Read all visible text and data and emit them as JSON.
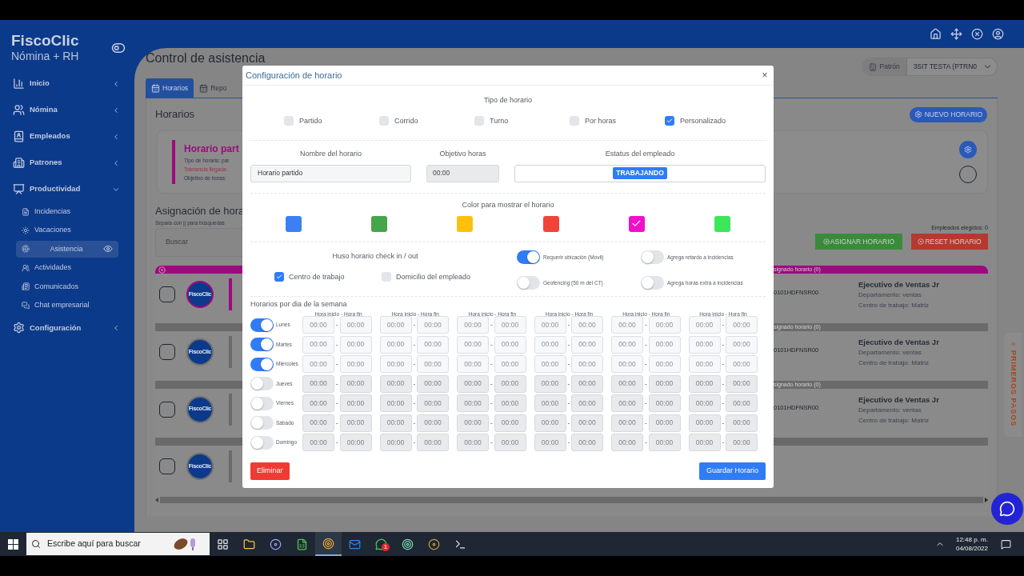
{
  "sidebar": {
    "logo": "FiscoClic",
    "subtitle": "Nómina + RH",
    "items": [
      {
        "label": "Inicio",
        "expanded": false
      },
      {
        "label": "Nómina",
        "expanded": false
      },
      {
        "label": "Empleados",
        "expanded": false
      },
      {
        "label": "Patrones",
        "expanded": false
      },
      {
        "label": "Productividad",
        "expanded": true,
        "children": [
          {
            "label": "Incidencias",
            "selected": false
          },
          {
            "label": "Vacaciones",
            "selected": false
          },
          {
            "label": "Asistencia",
            "selected": true
          },
          {
            "label": "Actividades",
            "selected": false
          },
          {
            "label": "Comunicados",
            "selected": false
          },
          {
            "label": "Chat empresarial",
            "selected": false
          }
        ]
      },
      {
        "label": "Configuración",
        "expanded": false
      }
    ]
  },
  "content": {
    "title": "Control de asistencia",
    "patron": {
      "label": "Patrón",
      "value": "3SIT TESTA (PTRN0"
    },
    "tabs": [
      {
        "label": "Horarios",
        "selected": true
      },
      {
        "label": "Repo",
        "selected": false
      }
    ],
    "heading": "Horarios",
    "new_button": "NUEVO HORARIO",
    "card": {
      "title": "Horario part",
      "radio_selected": false,
      "lines": [
        {
          "text": "Tipo de horario: par",
          "kind": "normal"
        },
        {
          "text": "Tolerancia llegada:",
          "kind": "warning"
        },
        {
          "text": "Objetivo de horas:",
          "kind": "normal"
        }
      ]
    },
    "assign": {
      "title": "Asignación de hora",
      "hint": "Separa con || para búsquedas",
      "search_placeholder": "Buscar",
      "count": "Empleados elegidos: 0",
      "assign_button": "ASIGNAR HORARIO",
      "reset_button": "RESET HORARIO"
    },
    "employees": [
      {
        "avatar": "FiscoClic",
        "highlighted": true,
        "checked": false,
        "header": "signado horario (0)",
        "rfc": "0101HDFNSR00",
        "position": "Ejecutivo de Ventas Jr",
        "department": "Departamento: ventas",
        "workplace": "Centro de trabajo: Matriz"
      },
      {
        "avatar": "FiscoClic",
        "highlighted": false,
        "checked": false,
        "header": "signado horario (0)",
        "rfc": "0101HDFNSR00",
        "position": "Ejecutivo de Ventas Jr",
        "department": "Departamento: ventas",
        "workplace": "Centro de trabajo: Matriz"
      },
      {
        "avatar": "FiscoClic",
        "highlighted": false,
        "checked": false,
        "header": "signado horario (0)",
        "rfc": "0101HDFNSR00",
        "position": "Ejecutivo de Ventas Jr",
        "department": "Departamento: ventas",
        "workplace": "Centro de trabajo: Matriz"
      },
      {
        "avatar": "FiscoClic",
        "highlighted": false,
        "checked": false
      }
    ],
    "side_tab": "PRIMEROS PASOS"
  },
  "modal": {
    "title": "Configuración de horario",
    "close": "×",
    "type_label": "Tipo de horario",
    "types": [
      {
        "label": "Partido",
        "checked": false
      },
      {
        "label": "Corrido",
        "checked": false
      },
      {
        "label": "Turno",
        "checked": false
      },
      {
        "label": "Por horas",
        "checked": false
      },
      {
        "label": "Personalizado",
        "checked": true
      }
    ],
    "name_label": "Nombre del horario",
    "name_value": "Horario partido",
    "goal_label": "Objetivo horas",
    "goal_value": "00:00",
    "status_label": "Estatus del empleado",
    "status_badge": "TRABAJANDO",
    "color_label": "Color para mostrar el horario",
    "colors": [
      {
        "color": "#3d80f5",
        "selected": false
      },
      {
        "color": "#46a64a",
        "selected": false
      },
      {
        "color": "#fdc00d",
        "selected": false
      },
      {
        "color": "#f2433a",
        "selected": false
      },
      {
        "color": "#f20fcb",
        "selected": true
      },
      {
        "color": "#3de65a",
        "selected": false
      }
    ],
    "tz_label": "Huso horario check in / out",
    "tz_options": [
      {
        "label": "Centro de trabajo",
        "checked": true
      },
      {
        "label": "Domicilio del empleado",
        "checked": false
      }
    ],
    "toggles": [
      {
        "label": "Requerir ubicación (Movil)",
        "on": true
      },
      {
        "label": "Agrega retardo a incidencias",
        "on": false
      },
      {
        "label": "Geofencing (50 m del CT)",
        "on": false
      },
      {
        "label": "Agrega horas extra a incidencias",
        "on": false
      }
    ],
    "week_label": "Horarios por dia de la semana",
    "slot_headers": [
      "Hora inicio - Hora fin",
      "Hora inicio - Hora fin",
      "Hora inicio - Hora fin",
      "Hora inicio - Hora fin",
      "Hora inicio - Hora fin",
      "Hora inicio - Hora fin"
    ],
    "separator": "-",
    "days": [
      {
        "name": "Lunes",
        "on": true,
        "slots": [
          {
            "start": "00:00",
            "end": "00:00"
          },
          {
            "start": "00:00",
            "end": "00:00"
          },
          {
            "start": "00:00",
            "end": "00:00"
          },
          {
            "start": "00:00",
            "end": "00:00"
          },
          {
            "start": "00:00",
            "end": "00:00"
          },
          {
            "start": "00:00",
            "end": "00:00"
          }
        ]
      },
      {
        "name": "Martes",
        "on": true,
        "slots": [
          {
            "start": "00:00",
            "end": "00:00"
          },
          {
            "start": "00:00",
            "end": "00:00"
          },
          {
            "start": "00:00",
            "end": "00:00"
          },
          {
            "start": "00:00",
            "end": "00:00"
          },
          {
            "start": "00:00",
            "end": "00:00"
          },
          {
            "start": "00:00",
            "end": "00:00"
          }
        ]
      },
      {
        "name": "Miércoles",
        "on": true,
        "slots": [
          {
            "start": "00:00",
            "end": "00:00"
          },
          {
            "start": "00:00",
            "end": "00:00"
          },
          {
            "start": "00:00",
            "end": "00:00"
          },
          {
            "start": "00:00",
            "end": "00:00"
          },
          {
            "start": "00:00",
            "end": "00:00"
          },
          {
            "start": "00:00",
            "end": "00:00"
          }
        ]
      },
      {
        "name": "Jueves",
        "on": false,
        "slots": [
          {
            "start": "00:00",
            "end": "00:00"
          },
          {
            "start": "00:00",
            "end": "00:00"
          },
          {
            "start": "00:00",
            "end": "00:00"
          },
          {
            "start": "00:00",
            "end": "00:00"
          },
          {
            "start": "00:00",
            "end": "00:00"
          },
          {
            "start": "00:00",
            "end": "00:00"
          }
        ]
      },
      {
        "name": "Viernes",
        "on": false,
        "slots": [
          {
            "start": "00:00",
            "end": "00:00"
          },
          {
            "start": "00:00",
            "end": "00:00"
          },
          {
            "start": "00:00",
            "end": "00:00"
          },
          {
            "start": "00:00",
            "end": "00:00"
          },
          {
            "start": "00:00",
            "end": "00:00"
          },
          {
            "start": "00:00",
            "end": "00:00"
          }
        ]
      },
      {
        "name": "Sábado",
        "on": false,
        "slots": [
          {
            "start": "00:00",
            "end": "00:00"
          },
          {
            "start": "00:00",
            "end": "00:00"
          },
          {
            "start": "00:00",
            "end": "00:00"
          },
          {
            "start": "00:00",
            "end": "00:00"
          },
          {
            "start": "00:00",
            "end": "00:00"
          },
          {
            "start": "00:00",
            "end": "00:00"
          }
        ]
      },
      {
        "name": "Domingo",
        "on": false,
        "slots": [
          {
            "start": "00:00",
            "end": "00:00"
          },
          {
            "start": "00:00",
            "end": "00:00"
          },
          {
            "start": "00:00",
            "end": "00:00"
          },
          {
            "start": "00:00",
            "end": "00:00"
          },
          {
            "start": "00:00",
            "end": "00:00"
          },
          {
            "start": "00:00",
            "end": "00:00"
          }
        ]
      }
    ],
    "delete_button": "Eliminar",
    "save_button": "Guardar Horario"
  },
  "taskbar": {
    "search_placeholder": "Escribe aquí para buscar",
    "badge": "1",
    "time": "12:48 p. m.",
    "date": "04/08/2022"
  }
}
